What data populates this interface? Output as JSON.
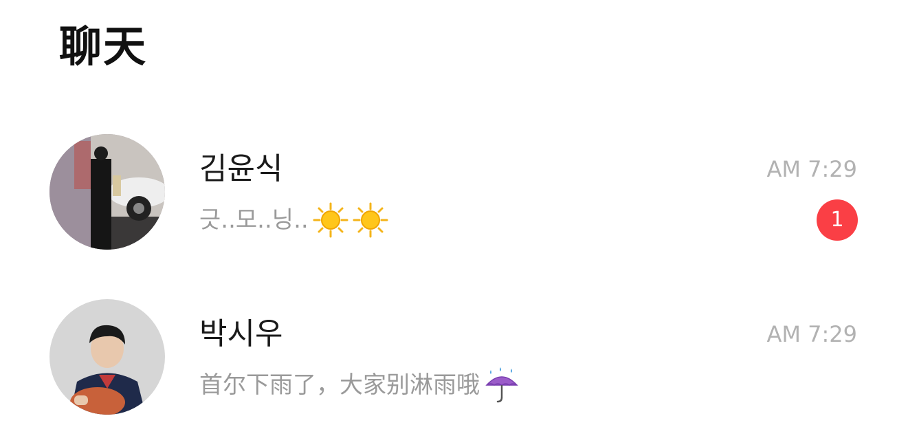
{
  "header": {
    "title": "聊天"
  },
  "chats": [
    {
      "name": "김윤식",
      "preview": "긋..모..닝..",
      "preview_emojis": [
        "sun-icon",
        "sun-icon"
      ],
      "time": "AM 7:29",
      "unread": "1",
      "avatar": "avatar-photo-man-street"
    },
    {
      "name": "박시우",
      "preview": "首尔下雨了，大家别淋雨哦",
      "preview_emojis": [
        "umbrella-rain-icon"
      ],
      "time": "AM 7:29",
      "avatar": "avatar-photo-man-sweater"
    }
  ],
  "colors": {
    "badge": "#fa3f45",
    "time_text": "#b2b2b2",
    "preview_text": "#9a9a9a",
    "name_text": "#1a1a1a"
  }
}
